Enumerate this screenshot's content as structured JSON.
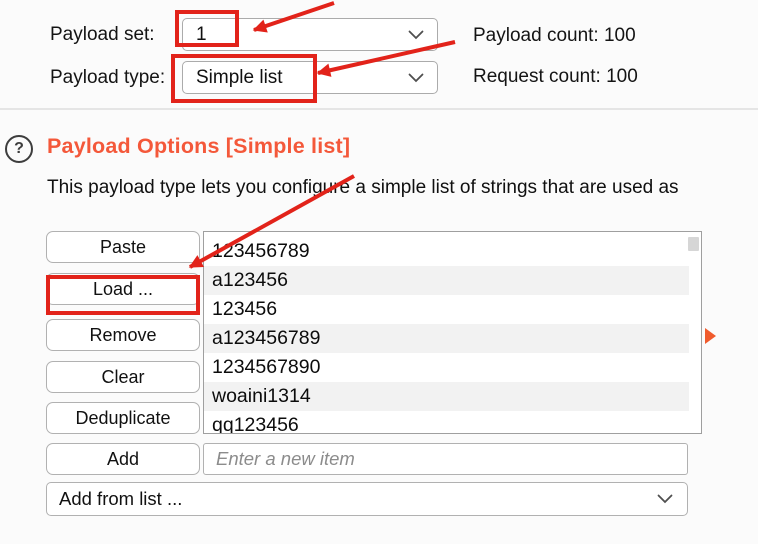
{
  "payload_sets": {
    "set_label": "Payload set:",
    "set_value": "1",
    "payload_count": "Payload count: 100",
    "type_label": "Payload type:",
    "type_value": "Simple list",
    "request_count": "Request count: 100"
  },
  "payload_options": {
    "help_icon": "?",
    "heading": "Payload Options [Simple list]",
    "description": "This payload type lets you configure a simple list of strings that are used as",
    "buttons": {
      "paste": "Paste",
      "load": "Load ...",
      "remove": "Remove",
      "clear": "Clear",
      "deduplicate": "Deduplicate",
      "add": "Add"
    },
    "list_items": [
      "123456789",
      "a123456",
      "123456",
      "a123456789",
      "1234567890",
      "woaini1314",
      "qq123456"
    ],
    "new_item_placeholder": "Enter a new item",
    "add_from_list_value": "Add from list ..."
  },
  "colors": {
    "heading_orange": "#f4583a",
    "annotation_red": "#e2231a",
    "list_marker_orange": "#f05b2d",
    "row_stripe_gray": "#f2f2f2"
  }
}
